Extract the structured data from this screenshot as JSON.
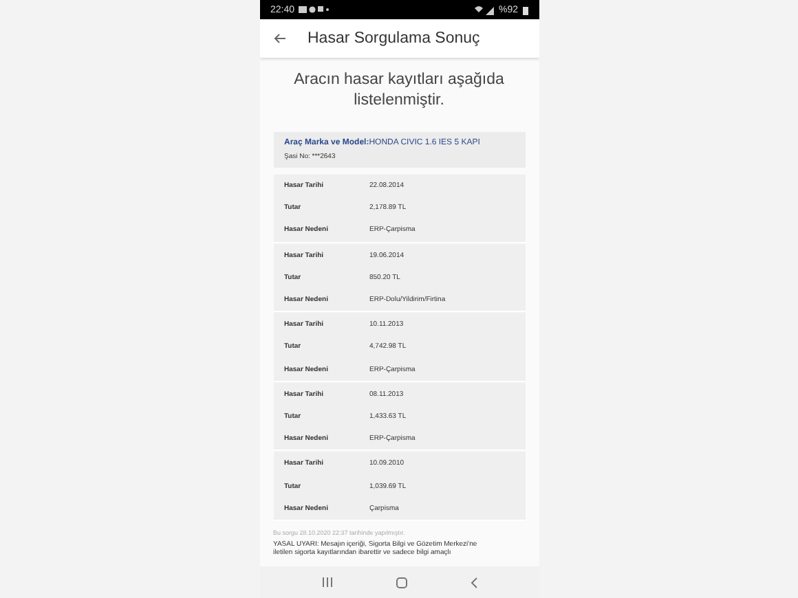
{
  "status_bar": {
    "time": "22:40",
    "battery": "%92"
  },
  "header": {
    "title": "Hasar Sorgulama Sonuç"
  },
  "intro": "Aracın hasar kayıtları aşağıda listelenmiştir.",
  "vehicle": {
    "model_label": "Araç Marka ve Model:",
    "model_value": "HONDA CIVIC 1.6 IES 5 KAPI",
    "chassis": "Şasi No: ***2643"
  },
  "records": [
    {
      "rows": [
        {
          "label": "Hasar Tarihi",
          "value": "22.08.2014"
        },
        {
          "label": "Tutar",
          "value": "2,178.89 TL"
        },
        {
          "label": "Hasar Nedeni",
          "value": "ERP-Çarpisma"
        }
      ]
    },
    {
      "rows": [
        {
          "label": "Hasar Tarihi",
          "value": "19.06.2014"
        },
        {
          "label": "Tutar",
          "value": "850.20 TL"
        },
        {
          "label": "Hasar Nedeni",
          "value": "ERP-Dolu/Yildirim/Firtina"
        }
      ]
    },
    {
      "rows": [
        {
          "label": "Hasar Tarihi",
          "value": "10.11.2013"
        },
        {
          "label": "Tutar",
          "value": "4,742.98 TL"
        },
        {
          "label": "Hasar Nedeni",
          "value": "ERP-Çarpisma"
        }
      ]
    },
    {
      "rows": [
        {
          "label": "Hasar Tarihi",
          "value": "08.11.2013"
        },
        {
          "label": "Tutar",
          "value": "1,433.63 TL"
        },
        {
          "label": "Hasar Nedeni",
          "value": "ERP-Çarpisma"
        }
      ]
    },
    {
      "rows": [
        {
          "label": "Hasar Tarihi",
          "value": "10.09.2010"
        },
        {
          "label": "Tutar",
          "value": "1,039.69 TL"
        },
        {
          "label": "Hasar Nedeni",
          "value": "Çarpisma"
        }
      ]
    }
  ],
  "query_note": "Bu sorgu 28.10.2020 22:37 tarihinde yapılmıştır.",
  "legal_notice": "YASAL UYARI: Mesajın içeriği, Sigorta Bilgi ve Gözetim Merkezi'ne iletilen sigorta kayıtlarından ibarettir ve sadece bilgi amaçlı"
}
